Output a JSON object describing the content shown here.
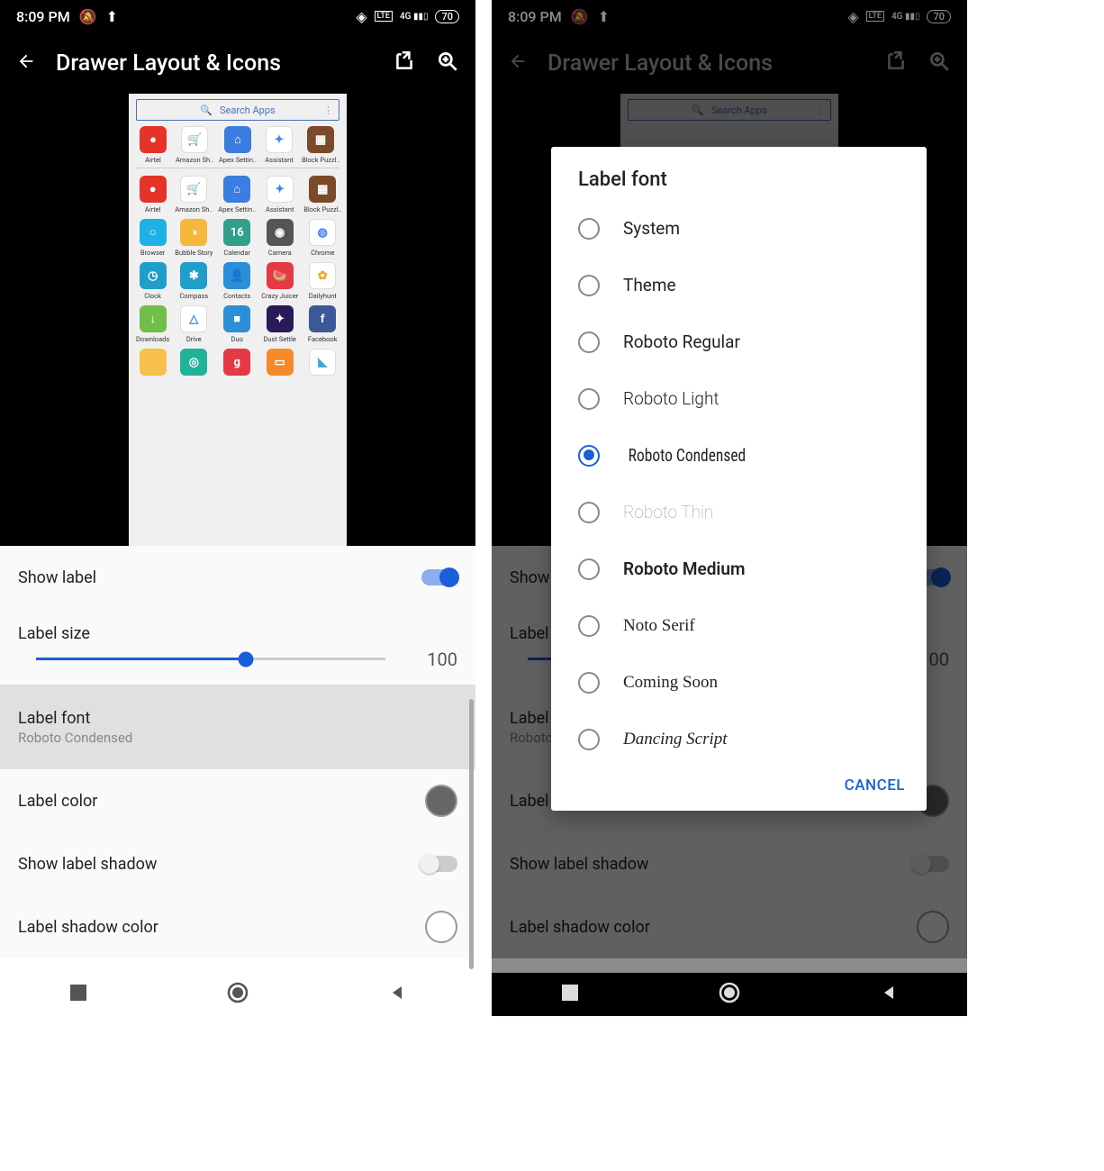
{
  "statusbar": {
    "time": "8:09 PM",
    "battery": "70"
  },
  "title": "Drawer Layout & Icons",
  "preview": {
    "search_placeholder": "Search Apps",
    "apps_row1": [
      {
        "label": "Airtel",
        "bg": "#e6332a",
        "glyph": "●"
      },
      {
        "label": "Amazon Sh..",
        "bg": "#fff",
        "glyph": "🛒",
        "fg": "#000",
        "border": "1"
      },
      {
        "label": "Apex Settin..",
        "bg": "#3b7de0",
        "glyph": "⌂"
      },
      {
        "label": "Assistant",
        "bg": "#fff",
        "glyph": "✦",
        "fg": "#4285f4",
        "border": "1"
      },
      {
        "label": "Block Puzzl..",
        "bg": "#7a4a2a",
        "glyph": "▦"
      }
    ],
    "apps_grid": [
      {
        "label": "Airtel",
        "bg": "#e6332a",
        "glyph": "●"
      },
      {
        "label": "Amazon Sh..",
        "bg": "#fff",
        "glyph": "🛒",
        "fg": "#000",
        "border": "1"
      },
      {
        "label": "Apex Settin..",
        "bg": "#3b7de0",
        "glyph": "⌂"
      },
      {
        "label": "Assistant",
        "bg": "#fff",
        "glyph": "✦",
        "fg": "#4285f4",
        "border": "1"
      },
      {
        "label": "Block Puzzl..",
        "bg": "#7a4a2a",
        "glyph": "▦"
      },
      {
        "label": "Browser",
        "bg": "#1db1e6",
        "glyph": "○"
      },
      {
        "label": "Bubble Story",
        "bg": "#f6b83c",
        "glyph": "◑"
      },
      {
        "label": "Calendar",
        "bg": "#2fa08a",
        "glyph": "16"
      },
      {
        "label": "Camera",
        "bg": "#555",
        "glyph": "◉"
      },
      {
        "label": "Chrome",
        "bg": "#fff",
        "glyph": "◍",
        "fg": "#4285f4",
        "border": "1"
      },
      {
        "label": "Clock",
        "bg": "#1f9eca",
        "glyph": "◷"
      },
      {
        "label": "Compass",
        "bg": "#1f9eca",
        "glyph": "✱"
      },
      {
        "label": "Contacts",
        "bg": "#2a8fd6",
        "glyph": "👤"
      },
      {
        "label": "Crazy Juicer",
        "bg": "#e63946",
        "glyph": "🍉"
      },
      {
        "label": "Dailyhunt",
        "bg": "#fff",
        "glyph": "✿",
        "fg": "#f5a623",
        "border": "1"
      },
      {
        "label": "Downloads",
        "bg": "#6fbf4a",
        "glyph": "↓"
      },
      {
        "label": "Drive",
        "bg": "#fff",
        "glyph": "△",
        "fg": "#4285f4",
        "border": "1"
      },
      {
        "label": "Duo",
        "bg": "#2a8fd6",
        "glyph": "■"
      },
      {
        "label": "Dust Settle",
        "bg": "#2a1a5a",
        "glyph": "✦"
      },
      {
        "label": "Facebook",
        "bg": "#3b5998",
        "glyph": "f"
      },
      {
        "label": "",
        "bg": "#f6c04a",
        "glyph": ""
      },
      {
        "label": "",
        "bg": "#1fb39a",
        "glyph": "◎"
      },
      {
        "label": "",
        "bg": "#e63946",
        "glyph": "g"
      },
      {
        "label": "",
        "bg": "#f68a2a",
        "glyph": "▭"
      },
      {
        "label": "",
        "bg": "#fff",
        "glyph": "◣",
        "fg": "#4ac",
        "border": "1"
      }
    ]
  },
  "settings": {
    "show_label": "Show label",
    "show_label_on": true,
    "label_size": "Label size",
    "label_size_value": "100",
    "label_size_pct": 60,
    "label_font": "Label font",
    "label_font_value": "Roboto Condensed",
    "label_color": "Label color",
    "label_color_value": "#666",
    "show_label_shadow": "Show label shadow",
    "show_label_shadow_on": false,
    "label_shadow_color": "Label shadow color",
    "label_shadow_color_value": "#fff"
  },
  "dialog": {
    "title": "Label font",
    "selected_index": 4,
    "options": [
      {
        "label": "System",
        "ff": "inherit"
      },
      {
        "label": "Theme",
        "ff": "inherit"
      },
      {
        "label": "Roboto Regular",
        "ff": "inherit"
      },
      {
        "label": "Roboto Light",
        "ff": "inherit",
        "fw": "300"
      },
      {
        "label": "Roboto Condensed",
        "ff": "'Roboto Condensed',sans-serif",
        "stretch": "85%"
      },
      {
        "label": "Roboto Thin",
        "ff": "inherit",
        "fw": "100",
        "color": "#999"
      },
      {
        "label": "Roboto Medium",
        "ff": "inherit",
        "fw": "600"
      },
      {
        "label": "Noto Serif",
        "ff": "Georgia,serif"
      },
      {
        "label": "Coming Soon",
        "ff": "'Comic Sans MS',cursive"
      },
      {
        "label": "Dancing Script",
        "ff": "'Brush Script MT',cursive",
        "fst": "italic"
      }
    ],
    "cancel": "CANCEL"
  }
}
